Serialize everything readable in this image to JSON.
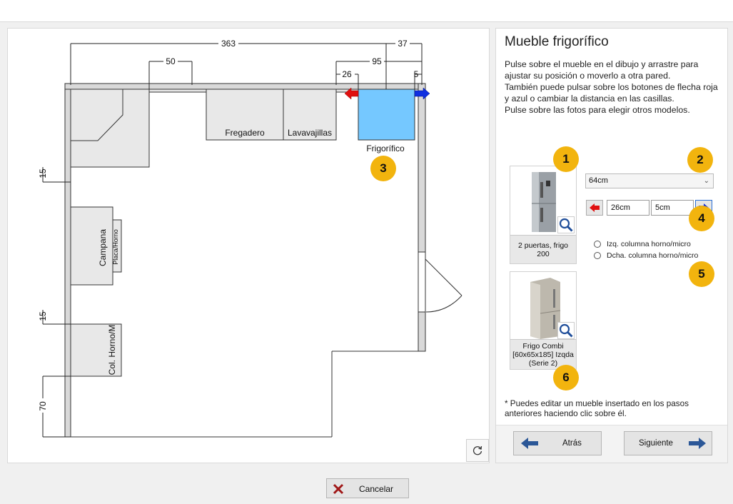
{
  "panel": {
    "title": "Mueble frigorífico",
    "instructions": "Pulse sobre el mueble en el dibujo y arrastre para ajustar su posición o moverlo a otra pared.\nTambién puede pulsar sobre los botones de flecha roja y azul o cambiar la distancia en las casillas.\nPulse sobre las fotos para elegir otros modelos.",
    "width_select": "64cm",
    "left_distance": "26cm",
    "right_distance": "5cm",
    "radio_left": "Izq. columna horno/micro",
    "radio_right": "Dcha. columna horno/micro",
    "photo1_caption": "2 puertas, frigo 200",
    "photo2_caption": "Frigo Combi [60x65x185] Izqda (Serie 2)",
    "note": "* Puedes editar un mueble insertado en los pasos anteriores haciendo clic sobre él.",
    "back_label": "Atrás",
    "next_label": "Siguiente",
    "badges": [
      "1",
      "2",
      "3",
      "4",
      "5",
      "6"
    ]
  },
  "plan": {
    "dims": {
      "d363": "363",
      "d37": "37",
      "d50": "50",
      "d95": "95",
      "d26": "26",
      "d5": "5",
      "d15a": "15",
      "d15b": "15",
      "d70": "70"
    },
    "labels": {
      "fregadero": "Fregadero",
      "lavavajillas": "Lavavajillas",
      "frigorifico": "Frigorífico",
      "campana": "Campana",
      "campana_partial": "Placa/Horno",
      "columna": "Col. Horno/M"
    }
  },
  "footer": {
    "cancel_label": "Cancelar"
  },
  "colors": {
    "accent_badge": "#f2b40e",
    "fridge_fill": "#75c8ff",
    "arrow_red": "#e01010",
    "arrow_blue": "#1030e0",
    "nav_arrow": "#2b5797"
  }
}
